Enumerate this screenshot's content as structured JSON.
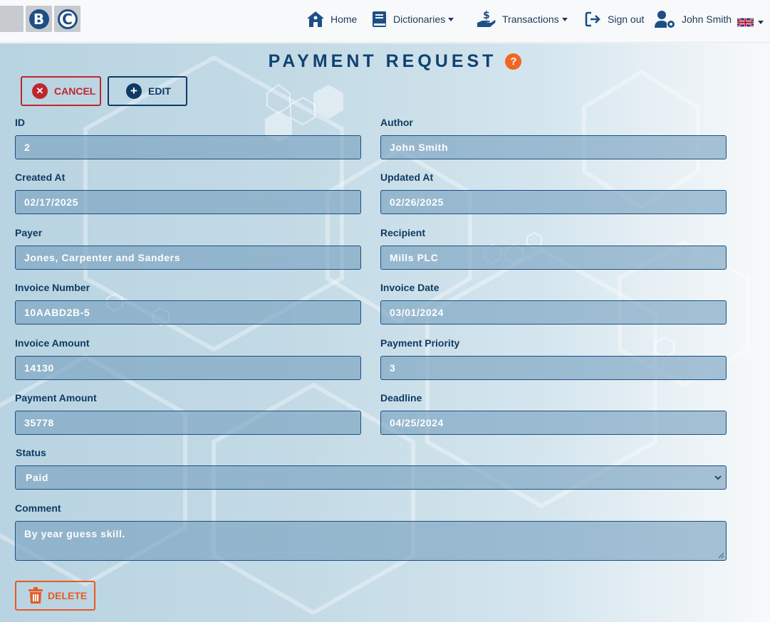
{
  "nav": {
    "home": "Home",
    "dictionaries": "Dictionaries",
    "transactions": "Transactions",
    "sign_out": "Sign out",
    "user": "John Smith"
  },
  "page": {
    "title": "PAYMENT REQUEST",
    "help": "?"
  },
  "actions": {
    "cancel": "CANCEL",
    "edit": "EDIT",
    "delete": "DELETE"
  },
  "form": {
    "id": {
      "label": "ID",
      "value": "2"
    },
    "author": {
      "label": "Author",
      "value": "John Smith"
    },
    "created_at": {
      "label": "Created At",
      "value": "02/17/2025"
    },
    "updated_at": {
      "label": "Updated At",
      "value": "02/26/2025"
    },
    "payer": {
      "label": "Payer",
      "value": "Jones, Carpenter and Sanders"
    },
    "recipient": {
      "label": "Recipient",
      "value": "Mills PLC"
    },
    "invoice_number": {
      "label": "Invoice Number",
      "value": "10AABD2B-5"
    },
    "invoice_date": {
      "label": "Invoice Date",
      "value": "03/01/2024"
    },
    "invoice_amount": {
      "label": "Invoice Amount",
      "value": "14130"
    },
    "payment_priority": {
      "label": "Payment Priority",
      "value": "3"
    },
    "payment_amount": {
      "label": "Payment Amount",
      "value": "35778"
    },
    "deadline": {
      "label": "Deadline",
      "value": "04/25/2024"
    },
    "status": {
      "label": "Status",
      "value": "Paid"
    },
    "comment": {
      "label": "Comment",
      "value": "By year guess skill."
    }
  },
  "colors": {
    "primary": "#0f3b63",
    "danger": "#c0262d",
    "accent": "#f26522"
  },
  "icons": {
    "home": "home-icon",
    "dictionaries": "book-icon",
    "transactions": "hand-dollar-icon",
    "sign_out": "sign-out-icon",
    "user": "user-gear-icon",
    "language": "uk-flag-icon"
  }
}
